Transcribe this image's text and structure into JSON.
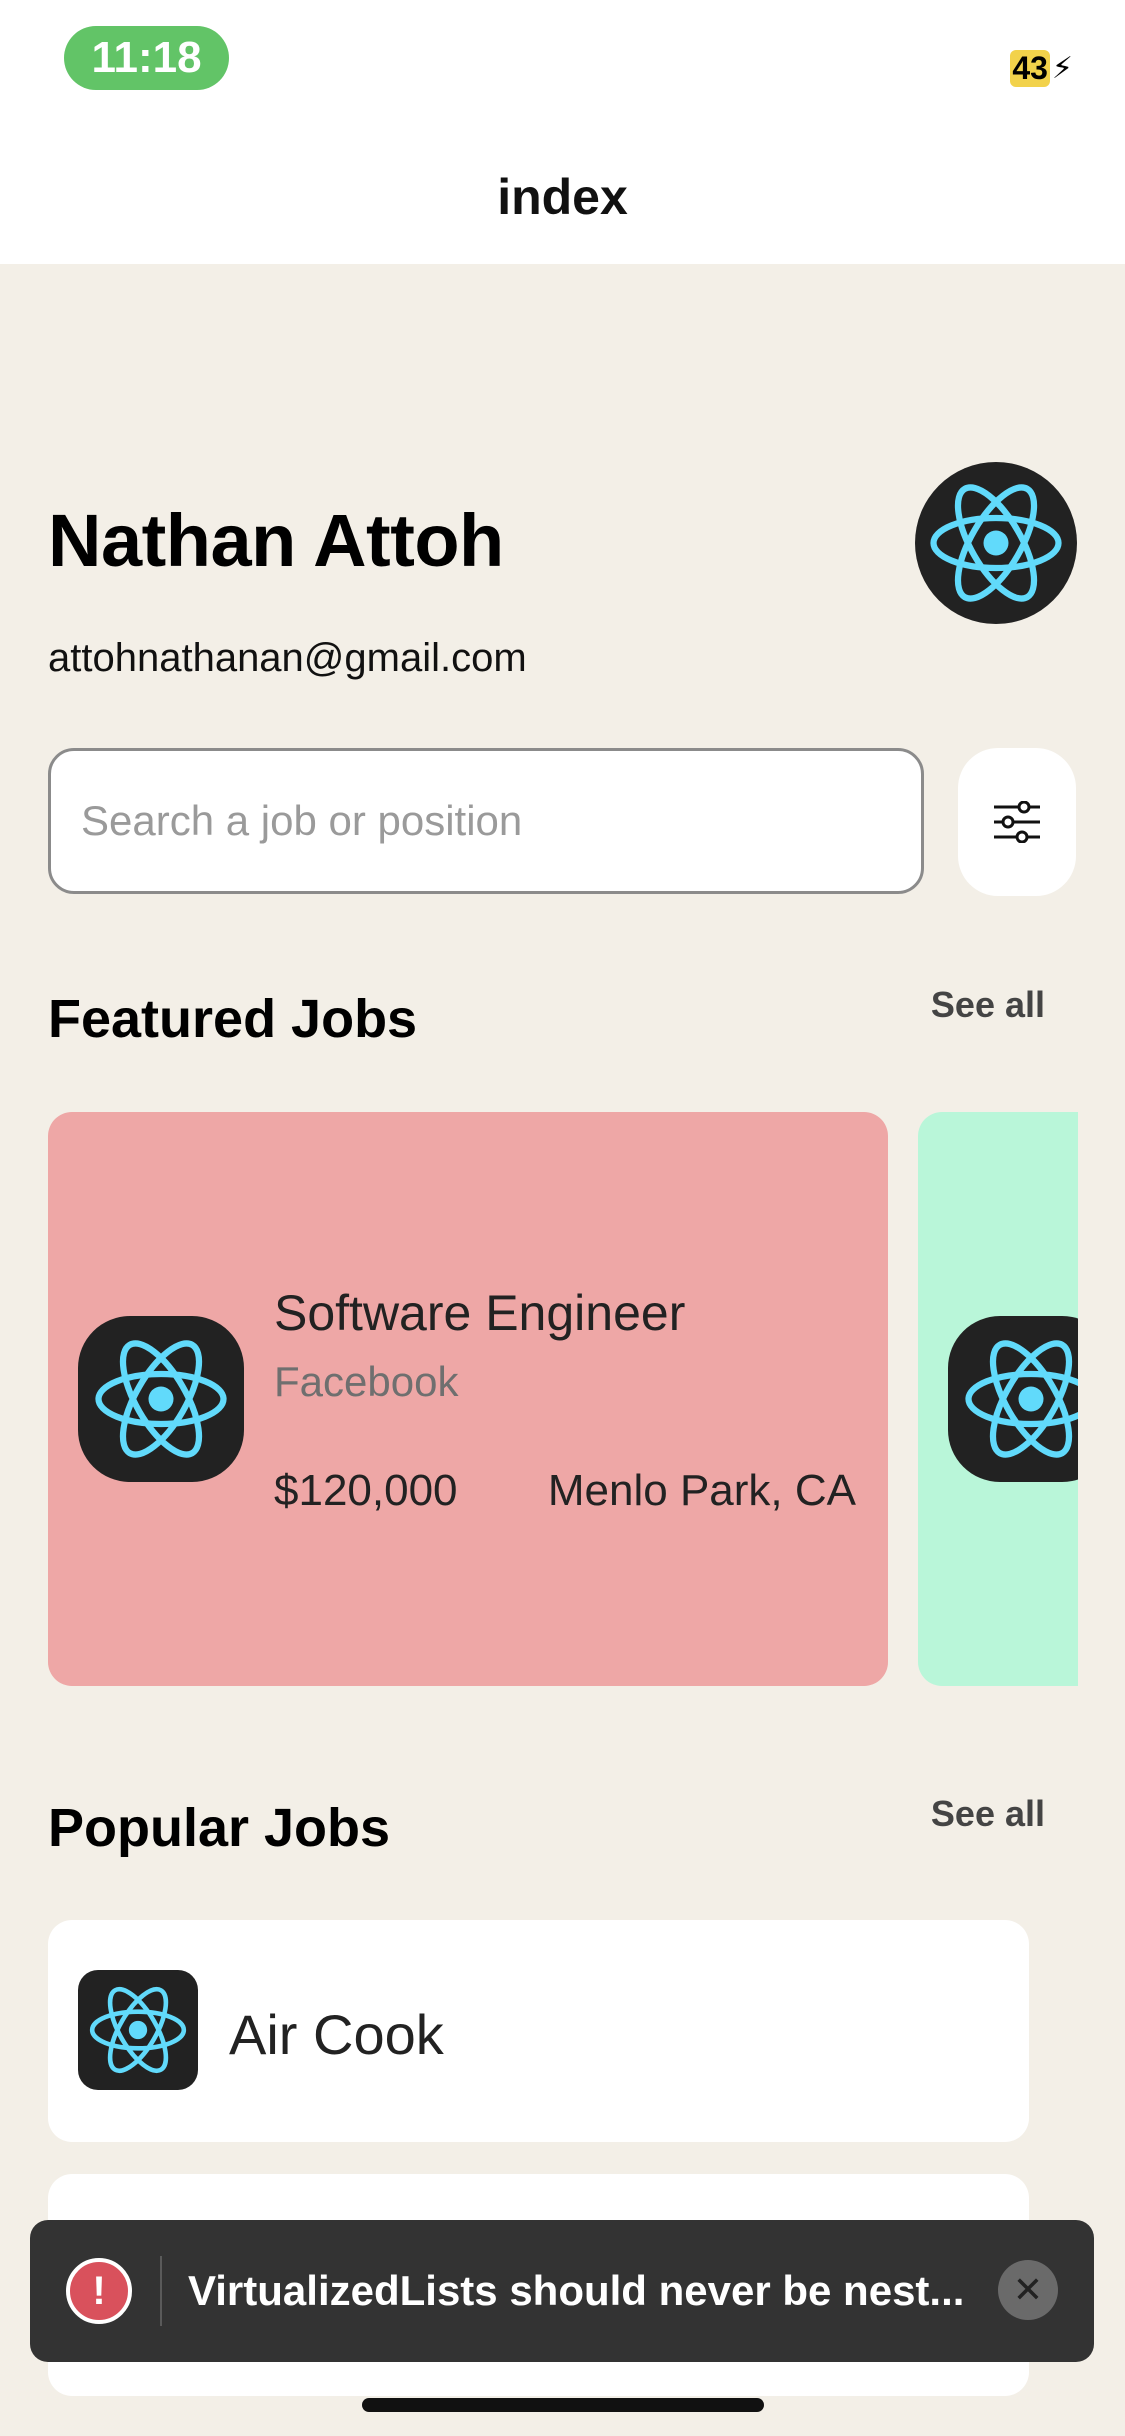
{
  "status_bar": {
    "time": "11:18",
    "battery": "43"
  },
  "nav": {
    "title": "index"
  },
  "profile": {
    "name": "Nathan Attoh",
    "email": "attohnathanan@gmail.com"
  },
  "search": {
    "placeholder": "Search a job or position",
    "value": ""
  },
  "featured": {
    "title": "Featured Jobs",
    "see_all": "See all",
    "jobs": [
      {
        "title": "Software Engineer",
        "company": "Facebook",
        "salary": "$120,000",
        "location": "Menlo Park, CA",
        "color": "#EEA7A6"
      },
      {
        "color": "#B9F6D9"
      }
    ]
  },
  "popular": {
    "title": "Popular Jobs",
    "see_all": "See all",
    "jobs": [
      {
        "title": "Air Cook"
      },
      {
        "title": ""
      }
    ]
  },
  "toast": {
    "message": "VirtualizedLists should never be nest..."
  },
  "icons": {
    "logo": "react-logo-icon",
    "filter": "sliders-icon",
    "error": "error-icon",
    "close": "close-icon"
  }
}
